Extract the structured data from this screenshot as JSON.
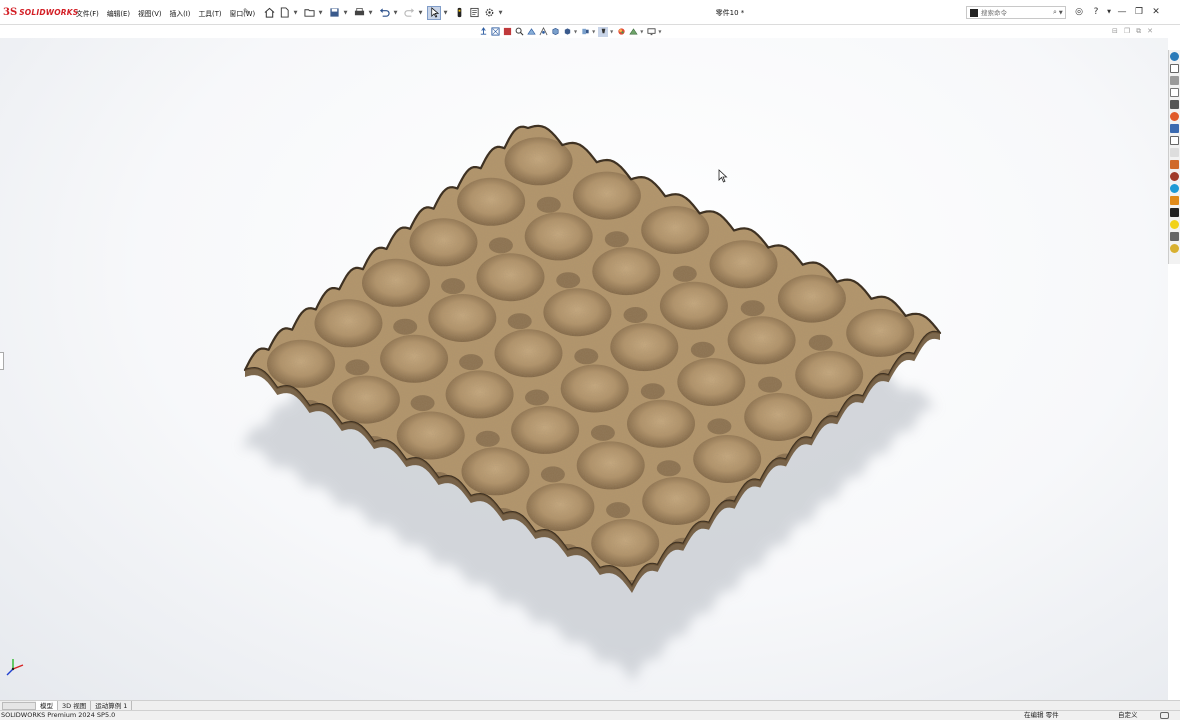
{
  "app": {
    "logo_mark": "3S",
    "logo_text": "SOLIDWORKS",
    "document_title": "零件10 *"
  },
  "menu": [
    "文件(F)",
    "编辑(E)",
    "视图(V)",
    "插入(I)",
    "工具(T)",
    "窗口(W)"
  ],
  "toolbar_icons": [
    "home-icon",
    "new-document-icon",
    "open-folder-icon",
    "save-icon",
    "print-icon",
    "undo-icon",
    "redo-icon",
    "select-icon",
    "rebuild-icon",
    "options-icon"
  ],
  "view_toolbar_icons": [
    "previous-view-icon",
    "zoom-to-fit-icon",
    "zoom-to-area-icon",
    "zoom-icon",
    "section-view-icon",
    "dynamic-annotation-icon",
    "view-orientation-icon",
    "display-style-icon",
    "hide-show-icon",
    "edit-appearance-icon",
    "scene-icon",
    "view-settings-icon",
    "display-icon"
  ],
  "search": {
    "placeholder": "搜索命令"
  },
  "window_controls": [
    "minimize-icon",
    "restore-icon",
    "close-icon"
  ],
  "colors": {
    "brand_red": "#d31e25",
    "model_surface": "#b8996e",
    "model_edge": "#4a3b28",
    "shadow": "#c8cbd0",
    "viewport_bg": "#f5f6f8"
  },
  "task_pane_icons": [
    "solidworks-resources-icon",
    "home-icon",
    "design-library-icon",
    "file-explorer-icon",
    "view-palette-icon",
    "appearances-icon",
    "custom-properties-icon",
    "solidworks-forum-icon",
    "3dexperience-icon",
    "markup-icon",
    "toolbox-icon",
    "solidworks-3dmarketplace-icon",
    "learning-icon",
    "note-icon",
    "cad-icon",
    "lightbulb-icon",
    "settings-icon"
  ],
  "tabs": [
    {
      "label": "模型",
      "active": true
    },
    {
      "label": "3D 视图",
      "active": false
    },
    {
      "label": "运动算例 1",
      "active": false
    }
  ],
  "status": {
    "product": "SOLIDWORKS Premium 2024 SP5.0",
    "editing": "在编辑 零件",
    "custom": "自定义"
  }
}
